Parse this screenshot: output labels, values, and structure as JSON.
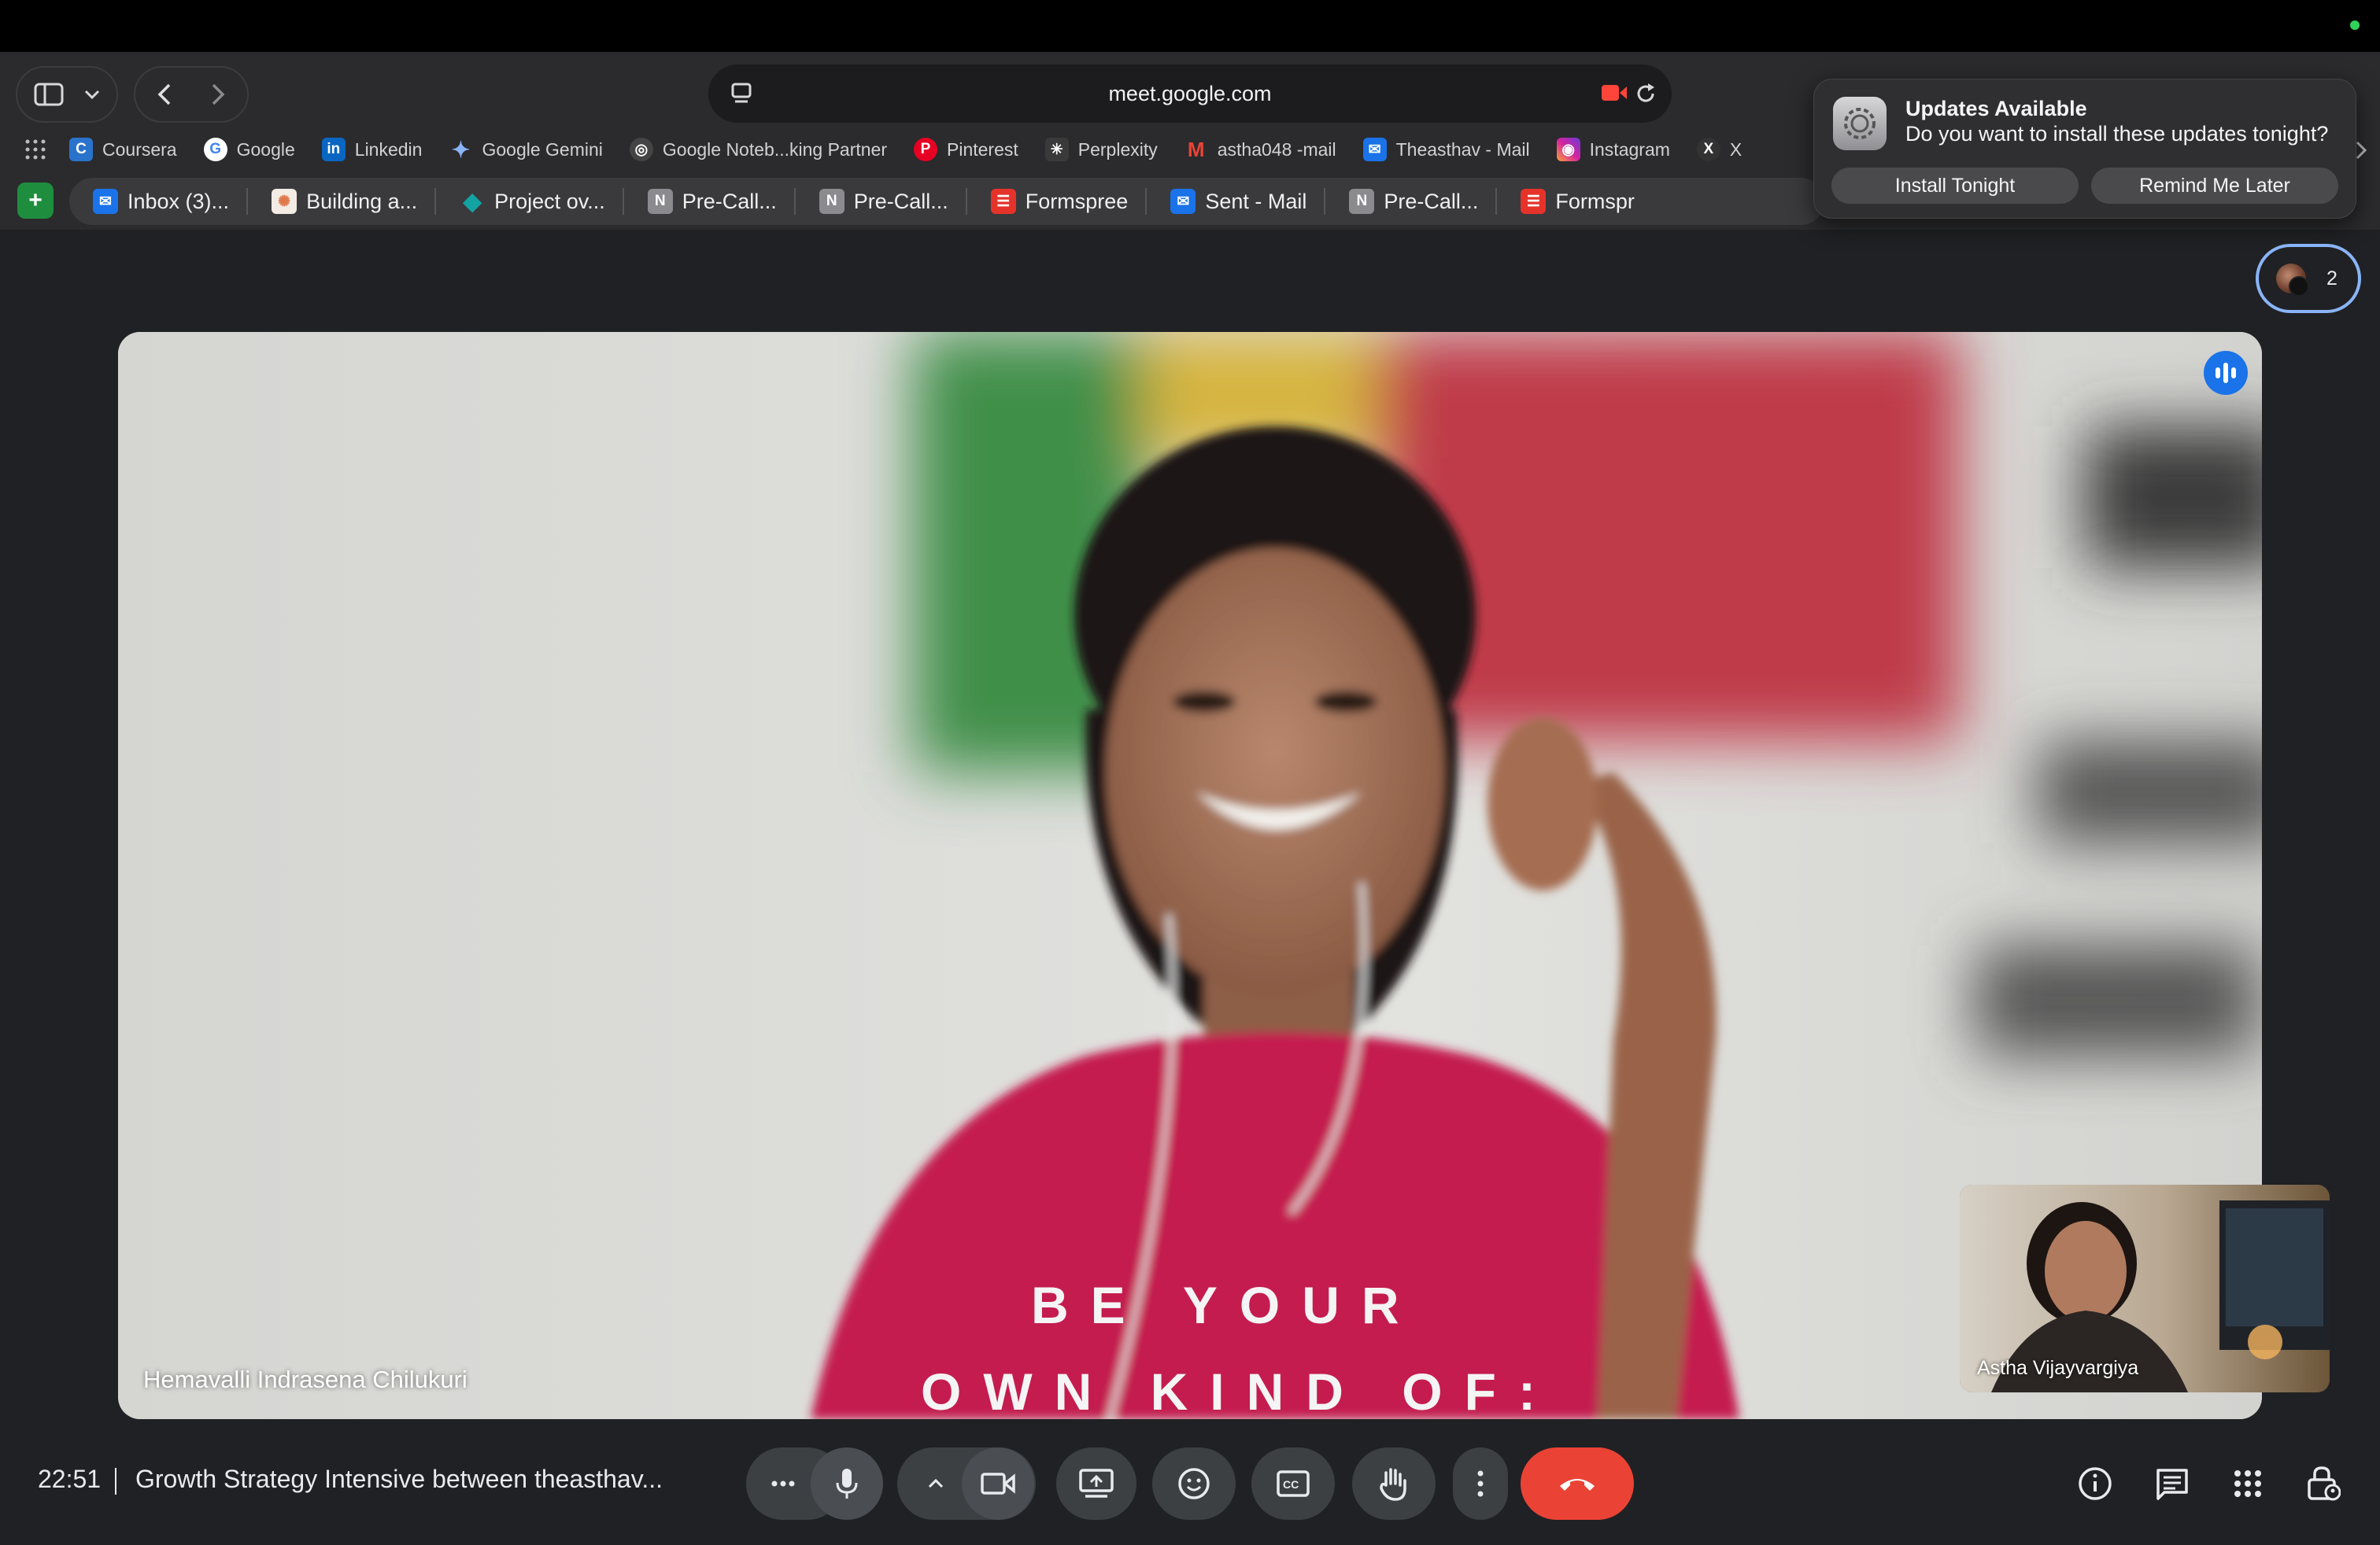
{
  "browser": {
    "url": "meet.google.com",
    "bookmarks": [
      {
        "label": "Coursera",
        "icon": "coursera-icon",
        "color": "#2a73cc",
        "glyph": "C"
      },
      {
        "label": "Google",
        "icon": "google-icon",
        "color": "#4285f4",
        "glyph": "G"
      },
      {
        "label": "Linkedin",
        "icon": "linkedin-icon",
        "color": "#0a66c2",
        "glyph": "in"
      },
      {
        "label": "Google Gemini",
        "icon": "gemini-icon",
        "color": "#6a7fe0",
        "glyph": "✦"
      },
      {
        "label": "Google Noteb...king Partner",
        "icon": "notebooklm-icon",
        "color": "#444",
        "glyph": "◎"
      },
      {
        "label": "Pinterest",
        "icon": "pinterest-icon",
        "color": "#e60023",
        "glyph": "P"
      },
      {
        "label": "Perplexity",
        "icon": "perplexity-icon",
        "color": "#3a3a3a",
        "glyph": "✳"
      },
      {
        "label": "astha048 -mail",
        "icon": "gmail-icon",
        "color": "#c5221f",
        "glyph": "M"
      },
      {
        "label": "Theasthav - Mail",
        "icon": "mail-icon",
        "color": "#1a73e8",
        "glyph": "✉"
      },
      {
        "label": "Instagram",
        "icon": "instagram-icon",
        "color": "#d6249f",
        "glyph": "◉"
      },
      {
        "label": "X",
        "icon": "x-icon",
        "color": "#333",
        "glyph": "X"
      }
    ],
    "tabs": [
      {
        "label": "Inbox (3)...",
        "icon": "mail-icon",
        "color": "#1a73e8",
        "glyph": "✉"
      },
      {
        "label": "Building a...",
        "icon": "claude-icon",
        "color": "#e0784b",
        "glyph": "✺"
      },
      {
        "label": "Project ov...",
        "icon": "diamond-icon",
        "color": "#14a3a3",
        "glyph": "◆"
      },
      {
        "label": "Pre-Call...",
        "icon": "notion-icon",
        "color": "#8a8a8f",
        "glyph": "N"
      },
      {
        "label": "Pre-Call...",
        "icon": "notion-icon",
        "color": "#8a8a8f",
        "glyph": "N"
      },
      {
        "label": "Formspree",
        "icon": "formspree-icon",
        "color": "#e5332a",
        "glyph": "☰"
      },
      {
        "label": "Sent - Mail",
        "icon": "mail-icon",
        "color": "#1a73e8",
        "glyph": "✉"
      },
      {
        "label": "Pre-Call...",
        "icon": "notion-icon",
        "color": "#8a8a8f",
        "glyph": "N"
      },
      {
        "label": "Formspr",
        "icon": "formspree-icon",
        "color": "#e5332a",
        "glyph": "☰"
      }
    ]
  },
  "notification": {
    "title": "Updates Available",
    "message": "Do you want to install these updates tonight?",
    "install_label": "Install Tonight",
    "remind_label": "Remind Me Later"
  },
  "meet": {
    "participant_count": "2",
    "main_speaker": "Hemavalli Indrasena Chilukuri",
    "shirt_text": [
      "BE YOUR",
      "OWN KIND OF:"
    ],
    "self_name": "Astha Vijayvargiya",
    "time": "22:51",
    "meeting_title": "Growth Strategy Intensive between theasthav...",
    "end_call_color": "#ea4335",
    "accent_color": "#8ab4f8"
  }
}
